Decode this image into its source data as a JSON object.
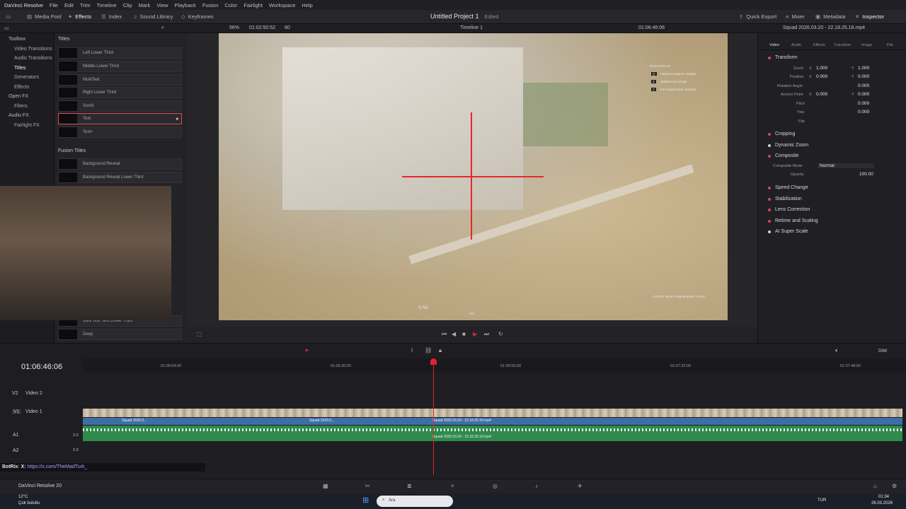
{
  "menu": {
    "app": "DaVinci Resolve",
    "items": [
      "File",
      "Edit",
      "Trim",
      "Timeline",
      "Clip",
      "Mark",
      "View",
      "Playback",
      "Fusion",
      "Color",
      "Fairlight",
      "Workspace",
      "Help"
    ]
  },
  "toolbar": {
    "media_pool": "Media Pool",
    "effects": "Effects",
    "index": "Index",
    "sound_library": "Sound Library",
    "keyframes": "Keyframes",
    "project_title": "Untitled Project 1",
    "project_status": "Edited",
    "quick_export": "Quick Export",
    "mixer": "Mixer",
    "metadata": "Metadata",
    "inspector": "Inspector"
  },
  "viewer_bar": {
    "zoom": "56%",
    "source_tc": "01:02:50:52",
    "fps": "60",
    "timeline_name": "Timeline 1",
    "timeline_tc": "01:06:46:06",
    "clip_name": "Squad 2026.03.20 - 22.18.25.18.mp4"
  },
  "left_panel": {
    "items": [
      "Toolbox",
      "Video Transitions",
      "Audio Transitions",
      "Titles",
      "Generators",
      "Effects",
      "Open FX",
      "Filters",
      "Audio FX",
      "Fairlight FX"
    ]
  },
  "effects": {
    "titles_header": "Titles",
    "fusion_header": "Fusion Titles",
    "titles": [
      "Left Lower Third",
      "Middle Lower Third",
      "MultiText",
      "Right Lower Third",
      "Scroll",
      "Text",
      "Text+"
    ],
    "fusion": [
      "Background Reveal",
      "Background Reveal Lower Third"
    ],
    "extra": [
      "Dark Box Text Lower Third",
      "Deep"
    ]
  },
  "hud": {
    "tags": [
      "Q",
      "Z",
      "C"
    ],
    "labels": [
      "Fakesunmogmez Degistir",
      "Sabitlemeye Degis",
      "Iris Kapanmayan Degistir"
    ],
    "header": "ANAHTARLAR",
    "weapon": "SUC/F6 30mm Fragmentation Tracer",
    "compass": "N       NE",
    "heading": "021"
  },
  "inspector": {
    "tabs": [
      "Video",
      "Audio",
      "Effects",
      "Transition",
      "Image",
      "File"
    ],
    "transform": "Transform",
    "zoom_lbl": "Zoom",
    "position_lbl": "Position",
    "rotation_lbl": "Rotation Angle",
    "anchor_lbl": "Anchor Point",
    "pitch_lbl": "Pitch",
    "yaw_lbl": "Yaw",
    "flip_lbl": "Flip",
    "zoom_x": "1.000",
    "zoom_y": "1.000",
    "pos_x": "0.000",
    "pos_y": "0.000",
    "rot": "0.000",
    "anch_x": "0.000",
    "anch_y": "0.000",
    "pitch": "0.000",
    "yaw": "0.000",
    "x": "X",
    "y": "Y",
    "cropping": "Cropping",
    "dynamic_zoom": "Dynamic Zoom",
    "composite": "Composite",
    "composite_mode_lbl": "Composite Mode",
    "composite_mode": "Normal",
    "opacity_lbl": "Opacity",
    "opacity": "100.00",
    "speed_change": "Speed Change",
    "stabilization": "Stabilization",
    "lens_correction": "Lens Correction",
    "retime": "Retime and Scaling",
    "super_scale": "AI Super Scale"
  },
  "timeline": {
    "timecode": "01:06:46:06",
    "ruler": [
      "01:06:04:00",
      "01:06:30:00",
      "01:06:56:00",
      "01:07:22:00",
      "01:07:48:00"
    ],
    "v2": "V2",
    "v2_name": "Video 2",
    "v1": "V1",
    "v1_name": "Video 1",
    "a1": "A1",
    "a2": "A2",
    "ch": "2.0",
    "clip": "Squad 2026.03.20 - 22.18.25.18.mp4",
    "clip_short": "Squad 2026.0...",
    "dim": "DIM"
  },
  "overlay": {
    "user": "BotRix",
    "sep": ":",
    "x": "X:",
    "url": "https://x.com/TheMadTurk_"
  },
  "footer": {
    "app_version": "DaVinci Resolve 20"
  },
  "taskbar": {
    "temp": "12°C",
    "weather": "Çok bulutlu",
    "search": "Ara",
    "lang": "TUR",
    "time": "01:34",
    "date": "26.03.2026"
  }
}
